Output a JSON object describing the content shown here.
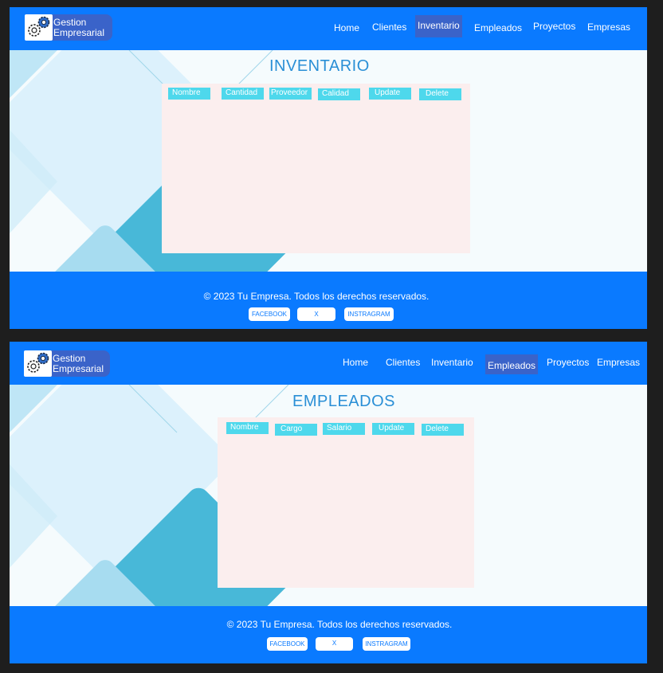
{
  "brand": {
    "line1": "Gestion",
    "line2": "Empresarial"
  },
  "nav": [
    "Home",
    "Clientes",
    "Inventario",
    "Empleados",
    "Proyectos",
    "Empresas"
  ],
  "inventario": {
    "title": "INVENTARIO",
    "active_nav": "Inventario",
    "columns": [
      "Nombre",
      "Cantidad",
      "Proveedor",
      "Calidad",
      "Update",
      "Delete"
    ]
  },
  "empleados": {
    "title": "EMPLEADOS",
    "active_nav": "Empleados",
    "columns": [
      "Nombre",
      "Cargo",
      "Salario",
      "Update",
      "Delete"
    ]
  },
  "footer": {
    "copyright": "© 2023 Tu Empresa. Todos los derechos reservados.",
    "social": [
      "FACEBOOK",
      "X",
      "INSTRAGRAM"
    ]
  },
  "colors": {
    "nav_bg": "#0a7aff",
    "active_nav": "#3a63c9",
    "header_cell": "#4ed8ec",
    "panel": "#fbeeee",
    "title": "#2a8fd6"
  },
  "icons": [
    "gears-icon"
  ]
}
